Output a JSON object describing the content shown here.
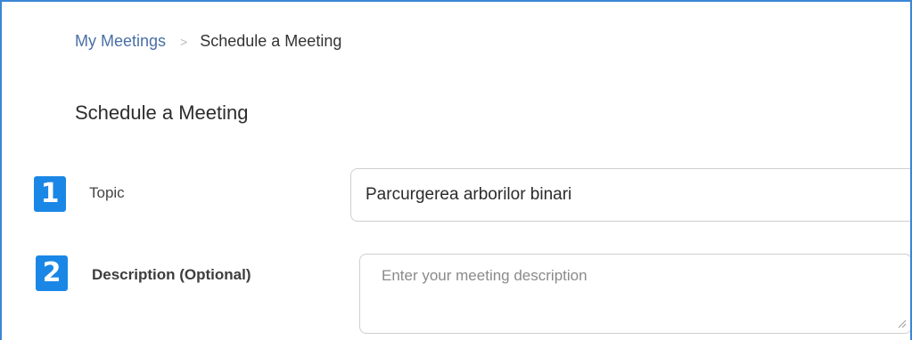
{
  "breadcrumb": {
    "parent": "My Meetings",
    "separator": ">",
    "current": "Schedule a Meeting"
  },
  "page": {
    "title": "Schedule a Meeting"
  },
  "steps": [
    {
      "number": "1",
      "label": "Topic",
      "value": "Parcurgerea arborilor binari"
    },
    {
      "number": "2",
      "label": "Description (Optional)",
      "placeholder": "Enter your meeting description"
    }
  ],
  "colors": {
    "accent": "#1a87e6",
    "frame_border": "#3b86d6",
    "link": "#4a6fa5"
  }
}
